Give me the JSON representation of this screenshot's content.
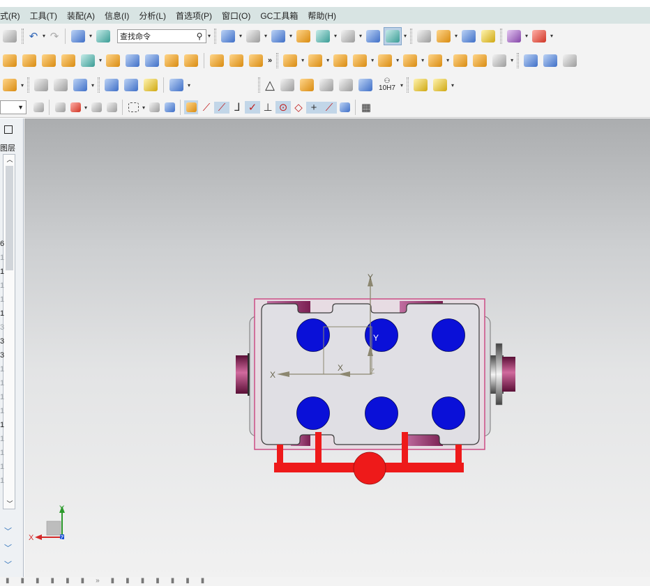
{
  "menu": [
    "式(R)",
    "工具(T)",
    "装配(A)",
    "信息(I)",
    "分析(L)",
    "首选项(P)",
    "窗口(O)",
    "GC工具箱",
    "帮助(H)"
  ],
  "toolbar": {
    "search_placeholder": "查找命令",
    "more_glyph": "»",
    "tolerance_label": "10H7"
  },
  "resource_bar": {
    "layer_label": "图层",
    "row_numbers": [
      "6",
      "1",
      "1",
      "1",
      "1",
      "1",
      "3",
      "3",
      "3",
      "1",
      "1",
      "1",
      "1",
      "1",
      "1",
      "1",
      "1",
      "1"
    ],
    "row_styles": [
      "dark",
      "light",
      "dark",
      "light",
      "light",
      "dark",
      "light",
      "dark",
      "dark",
      "light",
      "light",
      "light",
      "light",
      "dark",
      "light",
      "light",
      "light",
      "light"
    ]
  },
  "viewport": {
    "work_x_label": "X",
    "work_y_label": "Y",
    "csys_x_label": "X",
    "csys_y_label": "Y",
    "csys_z_label": "Z",
    "triad_x_label": "X",
    "triad_y_label": "Y",
    "triad_z_label": "Z"
  },
  "colors": {
    "menubar_bg": "#d8e4e3",
    "hole_blue": "#0a10d8",
    "pipe_red": "#ee1a1a",
    "boundary_pink": "#cc4c84",
    "port_magenta": "#8a1c55",
    "body_gray": "#e0dfe4"
  },
  "icons": {
    "toolbar1": [
      "open-icon",
      "undo-icon",
      "redo-icon",
      "layout-icon",
      "info-icon",
      "search-icon",
      "fit-icon",
      "brush-icon",
      "cube-icon",
      "book-icon",
      "flag-icon",
      "square-icon",
      "arrow-cube-icon",
      "assembly-icon",
      "report-icon",
      "constraint-icon",
      "measure-icon",
      "magic-icon",
      "play-icon",
      "grid-icon"
    ],
    "toolbar2": [
      "hammer-icon",
      "bricks-icon",
      "gear-icon",
      "block-icon",
      "sphere-icon",
      "box-icon",
      "sheet-icon",
      "plate-icon",
      "feature-icon",
      "mold-icon",
      "pipe-icon",
      "part-icon",
      "cover-icon",
      "nut-icon",
      "mesh-icon",
      "curve-icon",
      "surface-icon",
      "arch-icon"
    ],
    "toolbar3": [
      "chip-icon",
      "align-icon",
      "curve-icon",
      "measure-icon",
      "spring-icon",
      "tool-icon",
      "bearing-icon",
      "knife-icon",
      "triangle-icon",
      "table-icon",
      "drawing-icon",
      "group-icon",
      "note-icon",
      "dimension-icon",
      "binocular-icon",
      "stack-icon",
      "stack2-icon"
    ]
  }
}
